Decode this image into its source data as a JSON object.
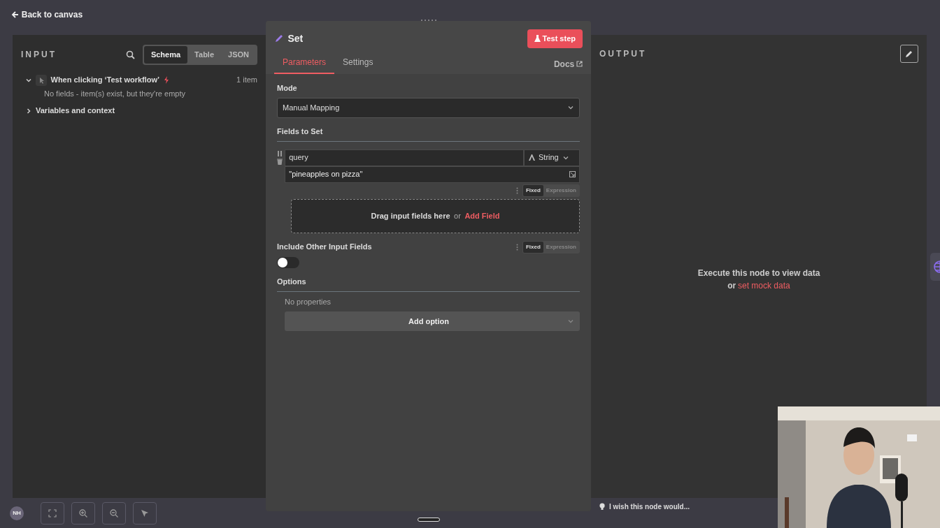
{
  "header": {
    "back_link": "Back to canvas"
  },
  "input_panel": {
    "title": "INPUT",
    "view_tabs": [
      {
        "label": "Schema",
        "selected": true
      },
      {
        "label": "Table",
        "selected": false
      },
      {
        "label": "JSON",
        "selected": false
      }
    ],
    "tree": [
      {
        "label": "When clicking ‘Test workflow’",
        "count": "1 item",
        "expanded": true,
        "note": "No fields - item(s) exist, but they're empty"
      },
      {
        "label": "Variables and context",
        "expanded": false
      }
    ]
  },
  "node": {
    "title": "Set",
    "test_button": "Test step",
    "tabs": [
      {
        "label": "Parameters",
        "selected": true
      },
      {
        "label": "Settings",
        "selected": false
      }
    ],
    "docs_link": "Docs",
    "mode": {
      "label": "Mode",
      "value": "Manual Mapping"
    },
    "fields_to_set": {
      "label": "Fields to Set",
      "fields": [
        {
          "name": "query",
          "type": "String",
          "value": "\"pineapples on pizza\"",
          "mode_options": [
            {
              "label": "Fixed",
              "selected": true
            },
            {
              "label": "Expression",
              "selected": false
            }
          ]
        }
      ],
      "drop_text": "Drag input fields here",
      "or": "or",
      "add_field": "Add Field"
    },
    "include_other": {
      "label": "Include Other Input Fields",
      "on": false,
      "mode_options": [
        {
          "label": "Fixed",
          "selected": true
        },
        {
          "label": "Expression",
          "selected": false
        }
      ]
    },
    "options": {
      "label": "Options",
      "empty_text": "No properties",
      "add_button": "Add option"
    }
  },
  "output_panel": {
    "title": "OUTPUT",
    "message": "Execute this node to view data",
    "or": "or",
    "mock_link": "set mock data"
  },
  "canvas_toolbar": {
    "avatar": "NH"
  },
  "feedback": "I wish this node would..."
}
